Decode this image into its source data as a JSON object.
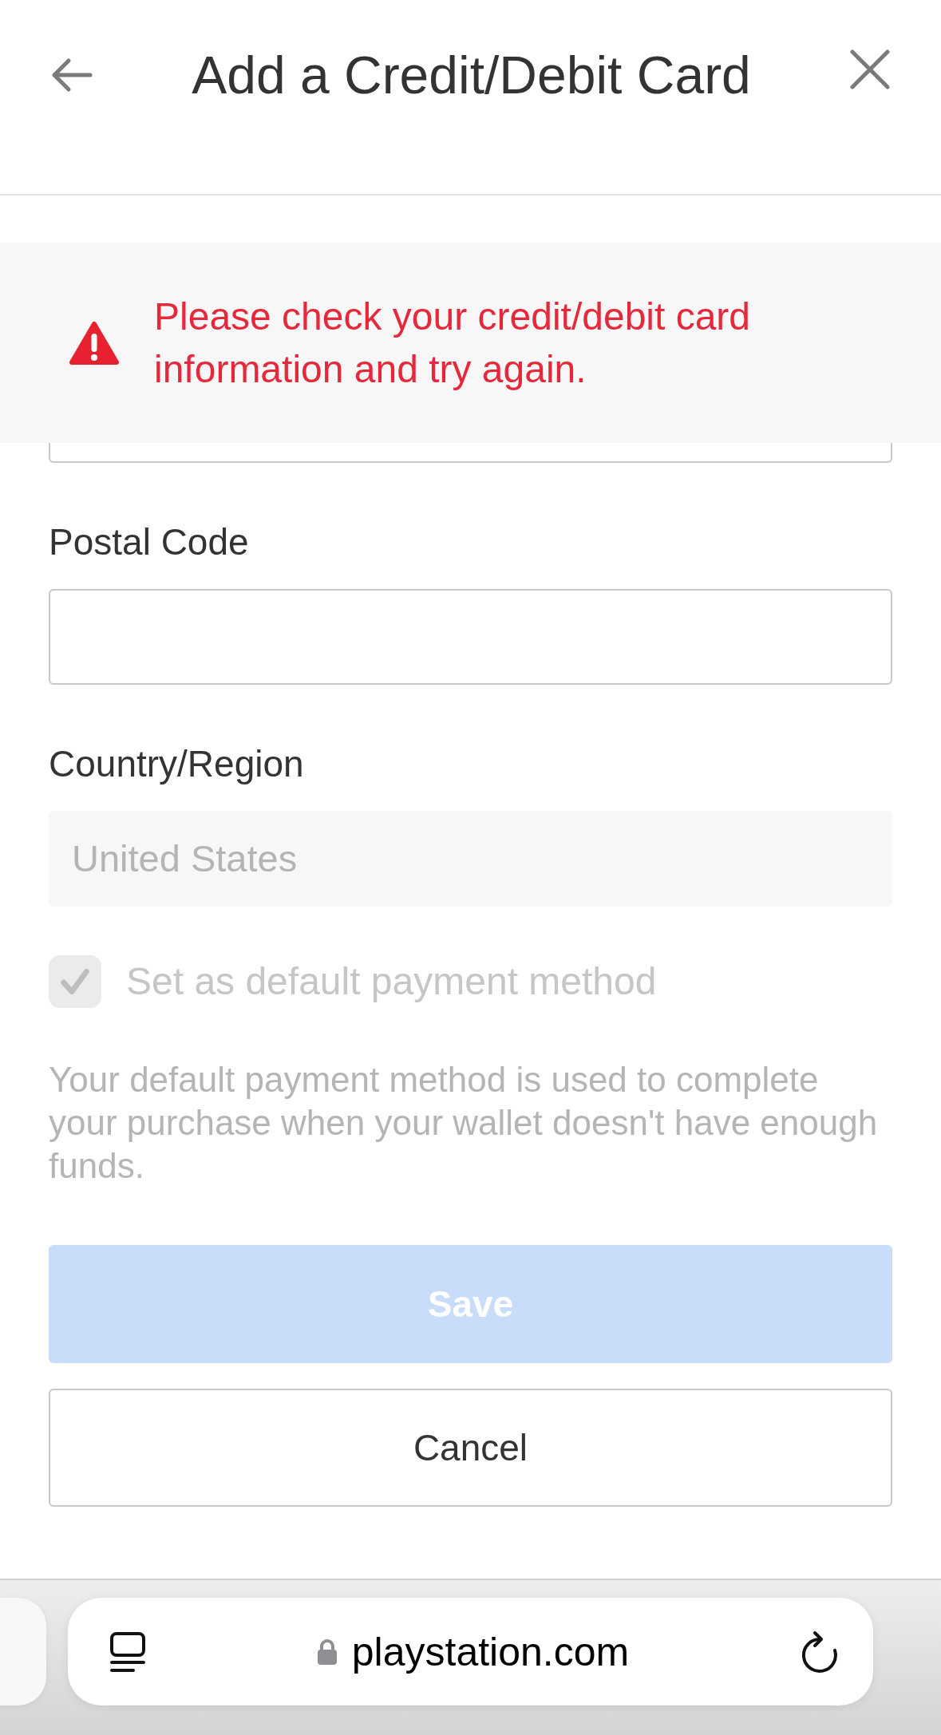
{
  "header": {
    "title": "Add a Credit/Debit Card"
  },
  "error_banner": {
    "message": "Please check your credit/debit card information and try again."
  },
  "fields": [
    {
      "kind": "partial"
    },
    {
      "kind": "text",
      "label": "Postal Code",
      "disabled": false
    },
    {
      "kind": "text",
      "label": "Country/Region",
      "value": "United States",
      "disabled": true
    }
  ],
  "checkbox": {
    "label": "Set as default payment method",
    "checked": true,
    "disabled": true
  },
  "note": "Your default payment method is used to complete your purchase when your wallet doesn't have enough funds.",
  "buttons": [
    {
      "kind": "primary",
      "label": "Save",
      "disabled": true
    },
    {
      "kind": "secondary",
      "label": "Cancel",
      "disabled": false
    }
  ],
  "browser_bar": {
    "url": "playstation.com"
  }
}
